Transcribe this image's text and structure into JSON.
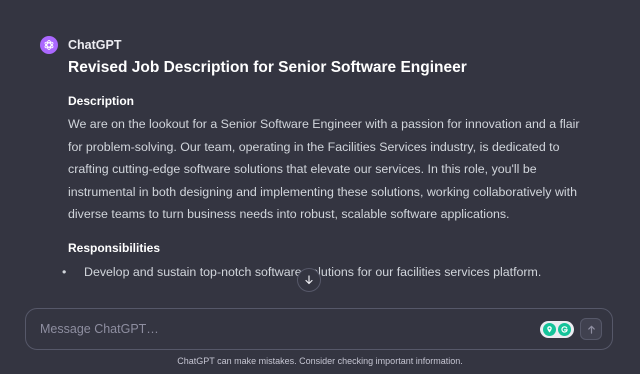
{
  "message": {
    "sender": "ChatGPT",
    "avatar_icon": "openai-logo-icon",
    "avatar_color": "#ab68ff",
    "title": "Revised Job Description for Senior Software Engineer",
    "description_heading": "Description",
    "description_text": "We are on the lookout for a Senior Software Engineer with a passion for innovation and a flair for problem-solving. Our team, operating in the Facilities Services industry, is dedicated to crafting cutting-edge software solutions that elevate our services. In this role, you'll be instrumental in both designing and implementing these solutions, working collaboratively with diverse teams to turn business needs into robust, scalable software applications.",
    "responsibilities_heading": "Responsibilities",
    "responsibilities": [
      "Develop and sustain top-notch software solutions for our facilities services platform."
    ]
  },
  "scroll_down_icon": "arrow-down-icon",
  "composer": {
    "placeholder": "Message ChatGPT…",
    "extension_icons": [
      "grammarly-location-icon",
      "grammarly-g-icon"
    ],
    "send_icon": "arrow-up-icon"
  },
  "footer": {
    "disclaimer": "ChatGPT can make mistakes. Consider checking important information."
  },
  "colors": {
    "background": "#343541",
    "text": "#d1d5db",
    "heading": "#ffffff",
    "grammarly_green": "#15c39a"
  }
}
